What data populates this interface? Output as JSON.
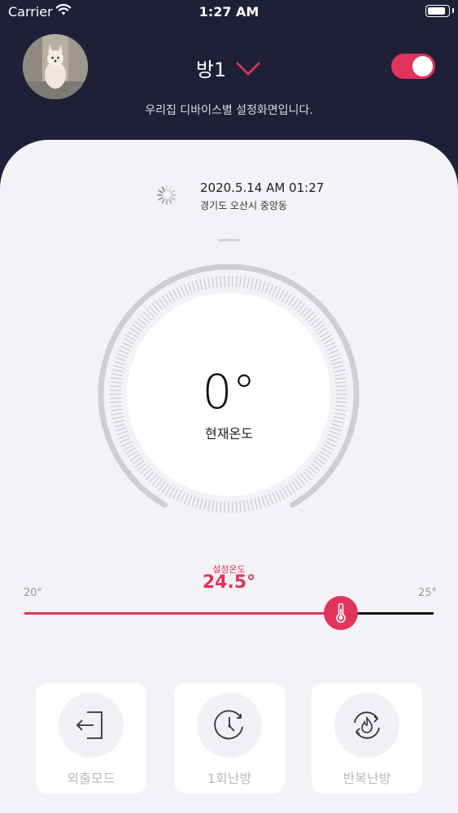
{
  "status_bar": {
    "carrier": "Carrier",
    "time": "1:27 AM"
  },
  "header": {
    "room_name": "방1",
    "subtitle": "우리집 디바이스별 설정화면입니다.",
    "power_on": true
  },
  "info": {
    "datetime": "2020.5.14 AM 01:27",
    "location": "경기도 오산시 중앙동"
  },
  "current_temp": {
    "value": "0°",
    "label": "현재온도"
  },
  "set_temp": {
    "label": "설정온도",
    "value": "24.5°",
    "min_label": "20°",
    "max_label": "25°",
    "min": 20,
    "max": 25,
    "current": 24.5
  },
  "modes": [
    {
      "label": "외출모드",
      "icon": "exit-door-icon"
    },
    {
      "label": "1회난방",
      "icon": "clock-icon"
    },
    {
      "label": "반복난방",
      "icon": "flame-repeat-icon"
    }
  ],
  "colors": {
    "accent": "#e2345b",
    "header": "#1f2038",
    "background": "#f3f3f7"
  }
}
